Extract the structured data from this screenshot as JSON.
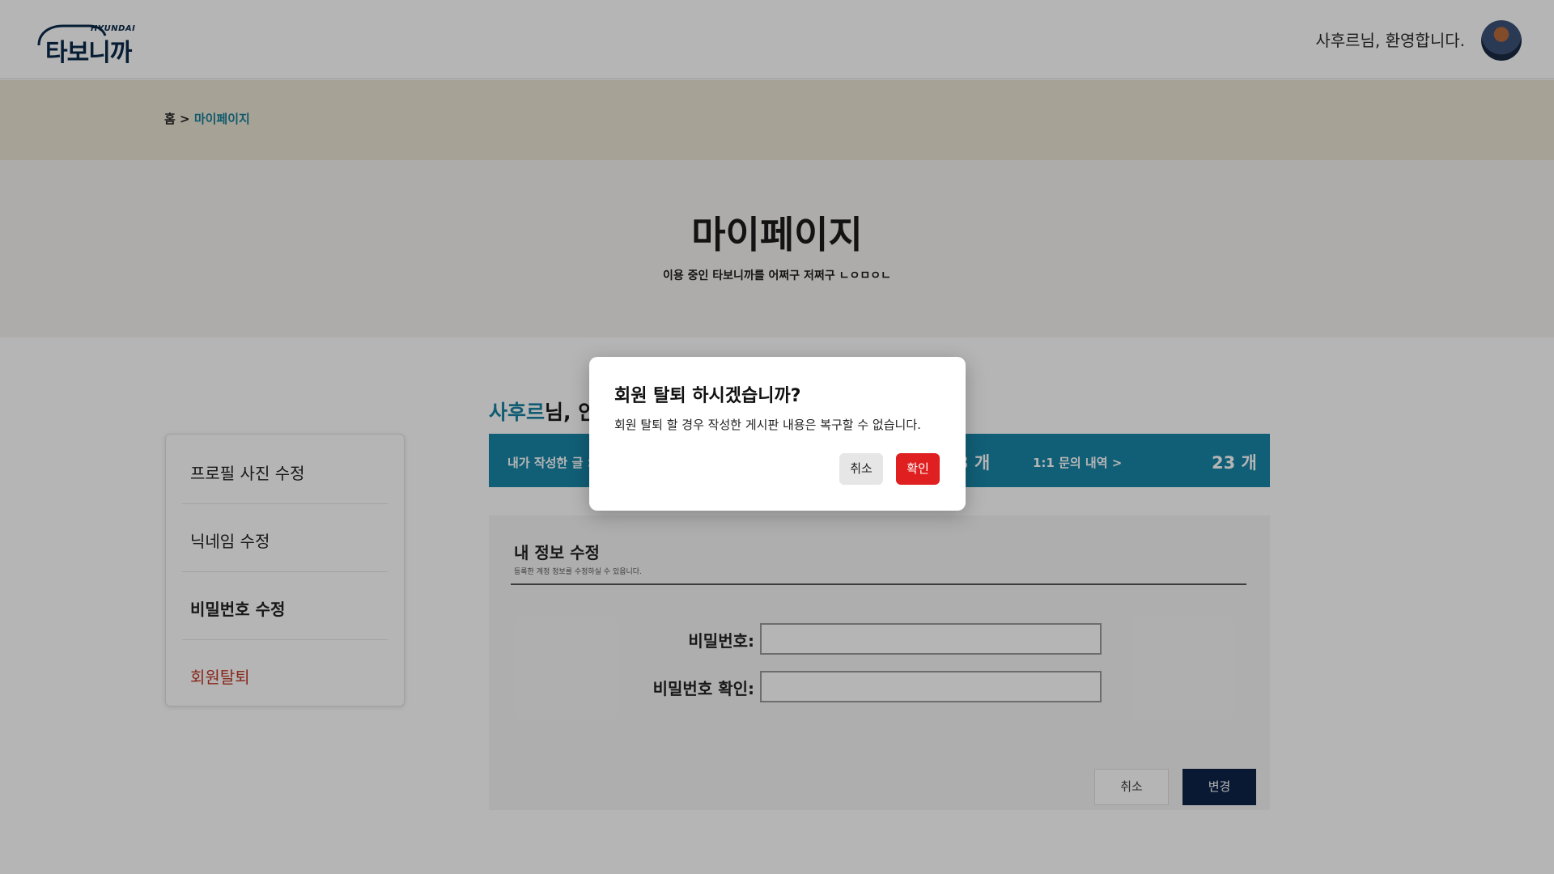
{
  "header": {
    "logo_brand": "HYUNDAI",
    "logo_name": "타보니까",
    "welcome": "사후르님, 환영합니다."
  },
  "breadcrumb": {
    "home": "홈 >",
    "current": "마이페이지"
  },
  "hero": {
    "title": "마이페이지",
    "subtitle": "이용 중인 타보니까를 어쩌구 저쩌구 ㄴㅇㅁㅇㄴ"
  },
  "sidebar": {
    "items": [
      {
        "label": "프로필 사진 수정"
      },
      {
        "label": "닉네임 수정"
      },
      {
        "label": "비밀번호 수정"
      },
      {
        "label": "회원탈퇴"
      }
    ]
  },
  "main": {
    "greeting_nick": "사후르",
    "greeting_rest": "님, 안",
    "stats": {
      "posts_link": "내가 작성한 글 >",
      "posts_count": "3 개",
      "inquiry_link": "1:1 문의 내역 >",
      "inquiry_count": "23 개"
    },
    "info": {
      "title": "내 정보 수정",
      "subtitle": "등록한 계정 정보를 수정하실 수 있읍니다.",
      "password_label": "비밀번호:",
      "password_confirm_label": "비밀번호 확인:",
      "cancel_label": "취소",
      "change_label": "변경"
    }
  },
  "modal": {
    "title": "회원 탈퇴 하시겠습니까?",
    "message": "회원 탈퇴 할 경우 작성한 게시판 내용은 복구할 수 없습니다.",
    "cancel_label": "취소",
    "confirm_label": "확인"
  },
  "colors": {
    "accent": "#1887a8",
    "navy": "#0d2448",
    "danger": "#e02020"
  }
}
